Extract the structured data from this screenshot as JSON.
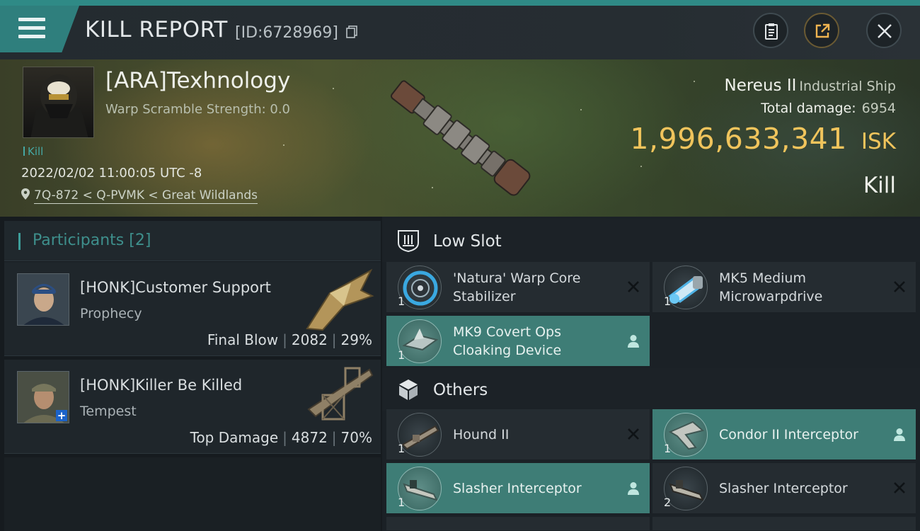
{
  "header": {
    "title": "KILL REPORT",
    "report_id": "[ID:6728969]"
  },
  "victim": {
    "name": "[ARA]Texhnology",
    "warp_scramble": "Warp Scramble Strength: 0.0",
    "tag": "Kill",
    "datetime": "2022/02/02 11:00:05 UTC -8",
    "location": "7Q-872 < Q-PVMK < Great Wildlands",
    "ship_name": "Nereus II",
    "ship_class": "Industrial Ship",
    "total_damage_label": "Total damage:",
    "total_damage": "6954",
    "isk_value": "1,996,633,341",
    "isk_unit": "ISK",
    "result": "Kill"
  },
  "participants": {
    "title": "Participants",
    "count": "[2]",
    "rows": [
      {
        "name": "[HONK]Customer Support",
        "ship": "Prophecy",
        "role": "Final Blow",
        "damage": "2082",
        "percent": "29%"
      },
      {
        "name": "[HONK]Killer Be Killed",
        "ship": "Tempest",
        "role": "Top Damage",
        "damage": "4872",
        "percent": "70%"
      }
    ]
  },
  "sections": {
    "low_slot": {
      "title": "Low Slot",
      "items": [
        {
          "name": "'Natura' Warp Core Stabilizer",
          "qty": "1",
          "state": "destroyed"
        },
        {
          "name": "MK5 Medium Microwarpdrive",
          "qty": "1",
          "state": "destroyed"
        },
        {
          "name": "MK9 Covert Ops Cloaking Device",
          "qty": "1",
          "state": "dropped"
        }
      ]
    },
    "others": {
      "title": "Others",
      "items": [
        {
          "name": "Hound II",
          "qty": "1",
          "state": "destroyed"
        },
        {
          "name": "Condor II Interceptor",
          "qty": "1",
          "state": "dropped"
        },
        {
          "name": "Slasher Interceptor",
          "qty": "1",
          "state": "dropped"
        },
        {
          "name": "Slasher Interceptor",
          "qty": "2",
          "state": "destroyed"
        }
      ]
    }
  },
  "colors": {
    "accent_teal": "#3e7d76",
    "isk_gold": "#f0c45c",
    "background": "#1b2126"
  },
  "icons": {
    "menu": "hamburger-icon",
    "copy": "copy-icon",
    "report": "clipboard-icon",
    "share": "share-icon",
    "close": "close-icon",
    "location": "location-pin-icon",
    "low_slot": "shield-slot-icon",
    "others": "cube-icon",
    "destroyed": "cross-icon",
    "dropped": "person-icon"
  }
}
